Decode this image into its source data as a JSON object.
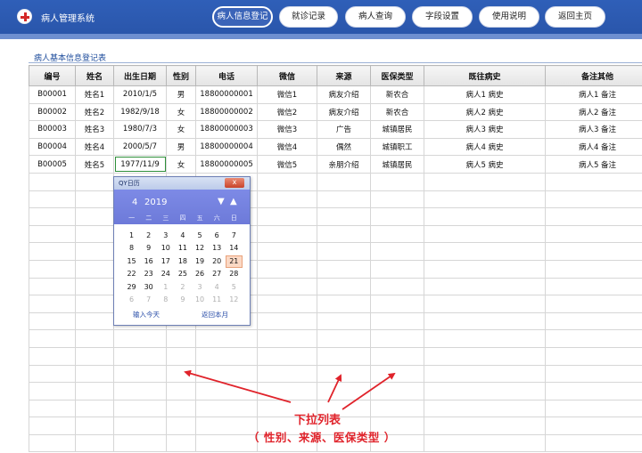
{
  "app": {
    "title": "病人管理系统",
    "logo_icon": "red-cross-icon"
  },
  "nav": [
    {
      "label": "病人信息登记",
      "active": true
    },
    {
      "label": "就诊记录",
      "active": false
    },
    {
      "label": "病人查询",
      "active": false
    },
    {
      "label": "字段设置",
      "active": false
    },
    {
      "label": "使用说明",
      "active": false
    },
    {
      "label": "返回主页",
      "active": false
    }
  ],
  "form": {
    "title": "病人基本信息登记表"
  },
  "table": {
    "columns": [
      "编号",
      "姓名",
      "出生日期",
      "性别",
      "电话",
      "微信",
      "来源",
      "医保类型",
      "既往病史",
      "备注其他"
    ],
    "rows": [
      [
        "B00001",
        "姓名1",
        "2010/1/5",
        "男",
        "18800000001",
        "微信1",
        "病友介绍",
        "新农合",
        "病人1 病史",
        "病人1 备注"
      ],
      [
        "B00002",
        "姓名2",
        "1982/9/18",
        "女",
        "18800000002",
        "微信2",
        "病友介绍",
        "新农合",
        "病人2 病史",
        "病人2 备注"
      ],
      [
        "B00003",
        "姓名3",
        "1980/7/3",
        "女",
        "18800000003",
        "微信3",
        "广告",
        "城镇居民",
        "病人3 病史",
        "病人3 备注"
      ],
      [
        "B00004",
        "姓名4",
        "2000/5/7",
        "男",
        "18800000004",
        "微信4",
        "偶然",
        "城镇职工",
        "病人4 病史",
        "病人4 备注"
      ],
      [
        "B00005",
        "姓名5",
        "1977/11/9",
        "女",
        "18800000005",
        "微信5",
        "亲朋介绍",
        "城镇居民",
        "病人5 病史",
        "病人5 备注"
      ]
    ],
    "selected_cell": {
      "row": 4,
      "col": 2
    }
  },
  "calendar": {
    "title": "QY日历",
    "month": "4",
    "year": "2019",
    "prev_symbol": "▼",
    "next_symbol": "▲",
    "weekdays": [
      "一",
      "二",
      "三",
      "四",
      "五",
      "六",
      "日"
    ],
    "days": [
      "1",
      "2",
      "3",
      "4",
      "5",
      "6",
      "7",
      "8",
      "9",
      "10",
      "11",
      "12",
      "13",
      "14",
      "15",
      "16",
      "17",
      "18",
      "19",
      "20",
      "21",
      "22",
      "23",
      "24",
      "25",
      "26",
      "27",
      "28",
      "29",
      "30",
      "1",
      "2",
      "3",
      "4",
      "5",
      "6",
      "7",
      "8",
      "9",
      "10",
      "11",
      "12"
    ],
    "current_month_days": 30,
    "today": "21",
    "today_button": "输入今天",
    "month_button": "返回本月",
    "close_symbol": "x"
  },
  "annotation": {
    "line1": "下拉列表",
    "line2": "（ 性别、来源、医保类型 ）",
    "color": "#e0232b"
  }
}
